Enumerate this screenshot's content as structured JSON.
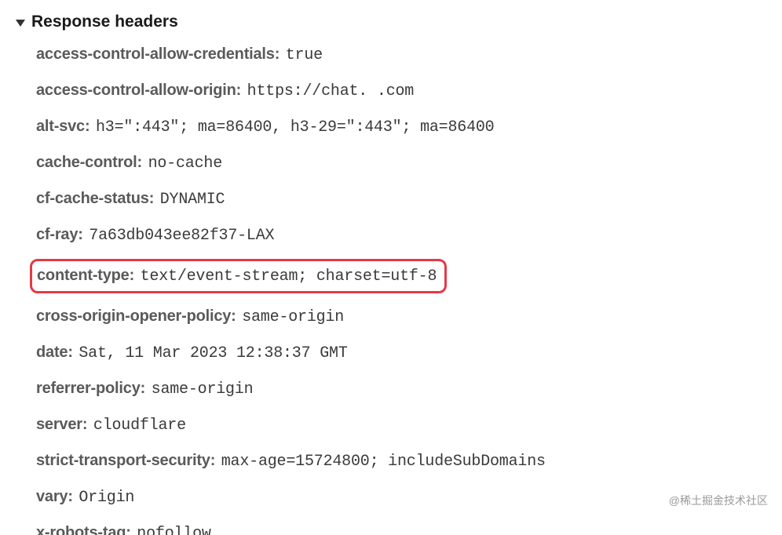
{
  "section": {
    "title": "Response headers"
  },
  "headers": {
    "access_control_allow_credentials": {
      "name": "access-control-allow-credentials:",
      "value": "true"
    },
    "access_control_allow_origin": {
      "name": "access-control-allow-origin:",
      "value": "https://chat.      .com"
    },
    "alt_svc": {
      "name": "alt-svc:",
      "value": "h3=\":443\"; ma=86400, h3-29=\":443\"; ma=86400"
    },
    "cache_control": {
      "name": "cache-control:",
      "value": "no-cache"
    },
    "cf_cache_status": {
      "name": "cf-cache-status:",
      "value": "DYNAMIC"
    },
    "cf_ray": {
      "name": "cf-ray:",
      "value": "7a63db043ee82f37-LAX"
    },
    "content_type": {
      "name": "content-type:",
      "value": "text/event-stream; charset=utf-8"
    },
    "cross_origin_opener_policy": {
      "name": "cross-origin-opener-policy:",
      "value": "same-origin"
    },
    "date": {
      "name": "date:",
      "value": "Sat, 11 Mar 2023 12:38:37 GMT"
    },
    "referrer_policy": {
      "name": "referrer-policy:",
      "value": "same-origin"
    },
    "server": {
      "name": "server:",
      "value": "cloudflare"
    },
    "strict_transport_security": {
      "name": "strict-transport-security:",
      "value": "max-age=15724800; includeSubDomains"
    },
    "vary": {
      "name": "vary:",
      "value": "Origin"
    },
    "x_robots_tag": {
      "name": "x-robots-tag:",
      "value": "nofollow"
    }
  },
  "watermark": "@稀土掘金技术社区"
}
